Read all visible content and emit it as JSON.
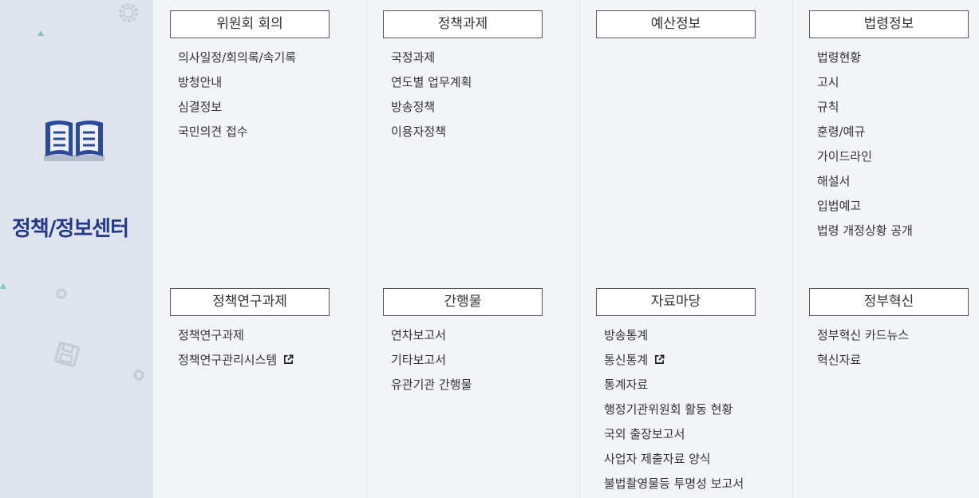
{
  "sidebar": {
    "title": "정책/정보센터",
    "icons": [
      "book-icon",
      "gear-icon",
      "floppy-disk-icon"
    ]
  },
  "sections": [
    {
      "title": "위원회 회의",
      "items": [
        {
          "label": "의사일정/회의록/속기록",
          "external": false
        },
        {
          "label": "방청안내",
          "external": false
        },
        {
          "label": "심결정보",
          "external": false
        },
        {
          "label": "국민의견 접수",
          "external": false
        }
      ]
    },
    {
      "title": "정책과제",
      "items": [
        {
          "label": "국정과제",
          "external": false
        },
        {
          "label": "연도별 업무계획",
          "external": false
        },
        {
          "label": "방송정책",
          "external": false
        },
        {
          "label": "이용자정책",
          "external": false
        }
      ]
    },
    {
      "title": "예산정보",
      "items": []
    },
    {
      "title": "법령정보",
      "items": [
        {
          "label": "법령현황",
          "external": false
        },
        {
          "label": "고시",
          "external": false
        },
        {
          "label": "규칙",
          "external": false
        },
        {
          "label": "훈령/예규",
          "external": false
        },
        {
          "label": "가이드라인",
          "external": false
        },
        {
          "label": "해설서",
          "external": false
        },
        {
          "label": "입법예고",
          "external": false
        },
        {
          "label": "법령 개정상황 공개",
          "external": false
        }
      ]
    },
    {
      "title": "정책연구과제",
      "items": [
        {
          "label": "정책연구과제",
          "external": false
        },
        {
          "label": "정책연구관리시스템",
          "external": true
        }
      ]
    },
    {
      "title": "간행물",
      "items": [
        {
          "label": "연차보고서",
          "external": false
        },
        {
          "label": "기타보고서",
          "external": false
        },
        {
          "label": "유관기관 간행물",
          "external": false
        }
      ]
    },
    {
      "title": "자료마당",
      "items": [
        {
          "label": "방송통계",
          "external": false
        },
        {
          "label": "통신통계",
          "external": true
        },
        {
          "label": "통계자료",
          "external": false
        },
        {
          "label": "행정기관위원회 활동 현황",
          "external": false
        },
        {
          "label": "국외 출장보고서",
          "external": false
        },
        {
          "label": "사업자 제출자료 양식",
          "external": false
        },
        {
          "label": "불법촬영물등 투명성 보고서",
          "external": false
        }
      ]
    },
    {
      "title": "정부혁신",
      "items": [
        {
          "label": "정부혁신 카드뉴스",
          "external": false
        },
        {
          "label": "혁신자료",
          "external": false
        }
      ]
    }
  ],
  "colors": {
    "sidebar_bg": "#dfe3ed",
    "title_blue": "#233a8a",
    "page_bg": "#f3f4f8"
  }
}
